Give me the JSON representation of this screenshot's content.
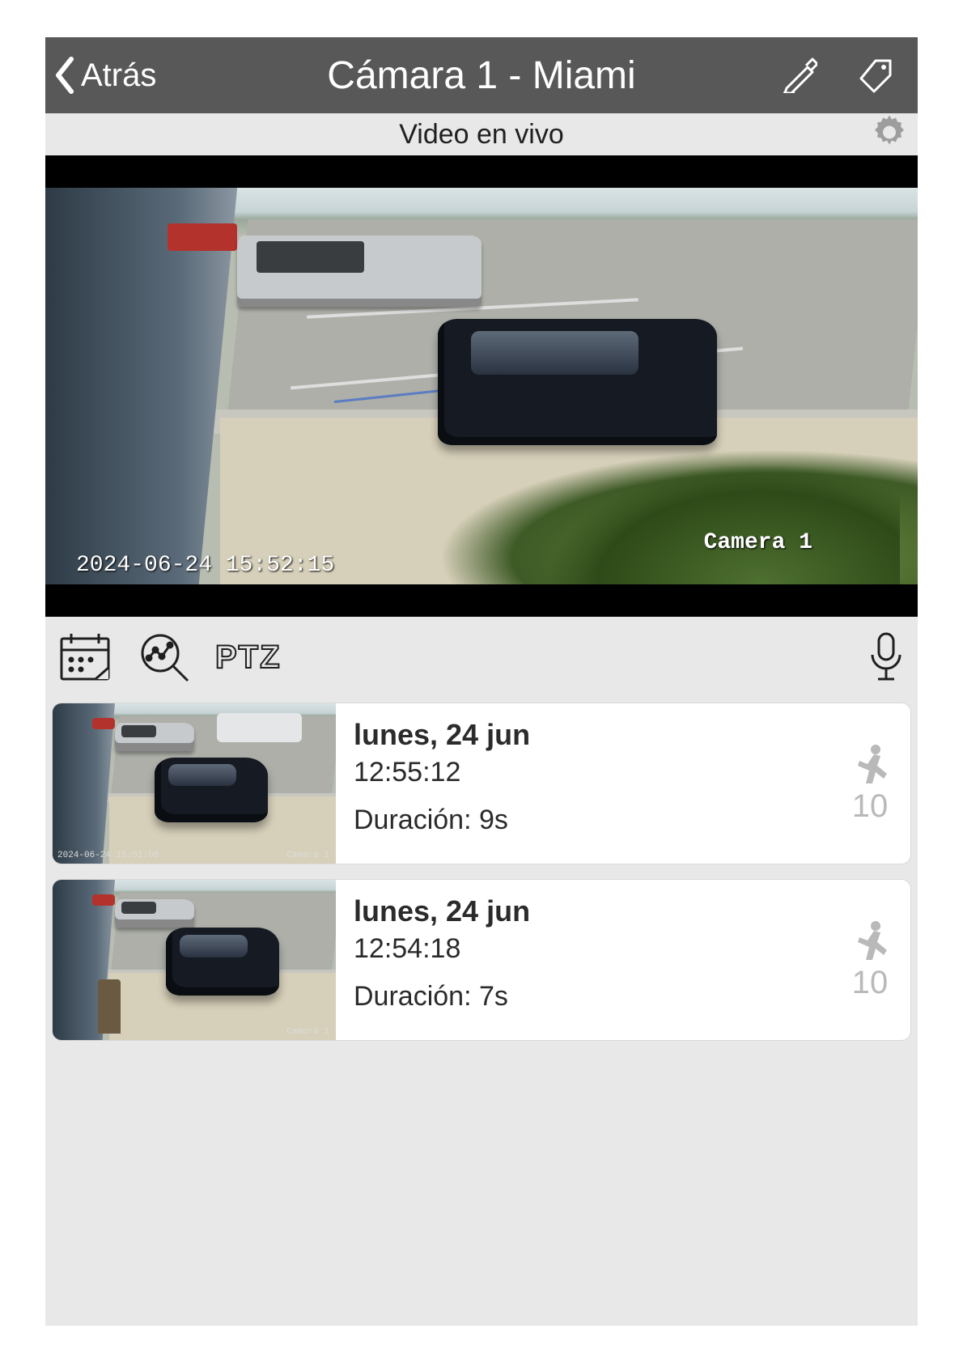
{
  "header": {
    "back_label": "Atrás",
    "title": "Cámara 1 - Miami"
  },
  "subheader": {
    "title": "Video en vivo"
  },
  "video": {
    "timestamp": "2024-06-24 15:52:15",
    "camera_label": "Camera 1"
  },
  "toolbar": {
    "ptz_label": "PTZ"
  },
  "events": [
    {
      "date": "lunes, 24 jun",
      "time": "12:55:12",
      "duration_label": "Duración: 9s",
      "count": "10",
      "thumb_ts": "2024-06-24 15:51:08",
      "thumb_cam": "Camera 1"
    },
    {
      "date": "lunes, 24 jun",
      "time": "12:54:18",
      "duration_label": "Duración: 7s",
      "count": "10",
      "thumb_ts": "",
      "thumb_cam": "Camera 1"
    }
  ]
}
